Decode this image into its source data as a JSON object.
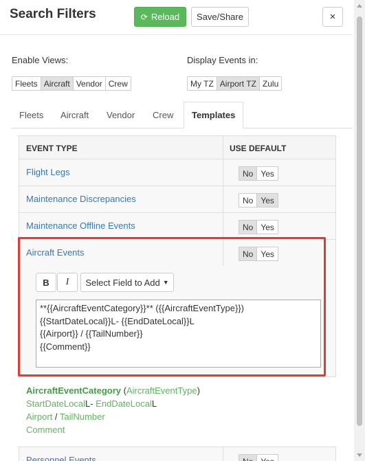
{
  "header": {
    "title": "Search Filters",
    "reload_label": "Reload",
    "save_label": "Save/Share",
    "close_label": "×"
  },
  "enable_views": {
    "label": "Enable Views:",
    "options": [
      "Fleets",
      "Aircraft",
      "Vendor",
      "Crew"
    ],
    "active": "Aircraft"
  },
  "display_events": {
    "label": "Display Events in:",
    "options": [
      "My TZ",
      "Airport TZ",
      "Zulu"
    ],
    "active": "Airport TZ"
  },
  "tabs": [
    "Fleets",
    "Aircraft",
    "Vendor",
    "Crew",
    "Templates"
  ],
  "active_tab": "Templates",
  "table": {
    "col_event_type": "EVENT TYPE",
    "col_use_default": "USE DEFAULT",
    "rows": [
      {
        "name": "Flight Legs",
        "no": "No",
        "yes": "Yes",
        "selected": "No"
      },
      {
        "name": "Maintenance Discrepancies",
        "no": "No",
        "yes": "Yes",
        "selected": "Yes"
      },
      {
        "name": "Maintenance Offline Events",
        "no": "No",
        "yes": "Yes",
        "selected": "No"
      },
      {
        "name": "Aircraft Events",
        "no": "No",
        "yes": "Yes",
        "selected": "No"
      },
      {
        "name": "Personnel Events",
        "no": "No",
        "yes": "Yes",
        "selected": "No"
      }
    ]
  },
  "editor": {
    "bold_label": "B",
    "italic_label": "I",
    "select_field_label": "Select Field to Add",
    "template_lines": [
      "**{{AircraftEventCategory}}** ({{AircraftEventType}})",
      "{{StartDateLocal}}L- {{EndDateLocal}}L",
      "{{Airport}} / {{TailNumber}}",
      "{{Comment}}"
    ]
  },
  "preview": {
    "l1_bold": "AircraftEventCategory",
    "l1_open": " (",
    "l1_type": "AircraftEventType",
    "l1_close": ")",
    "l2_start": "StartDateLocal",
    "l2_mid": "L- ",
    "l2_end": "EndDateLocal",
    "l2_suffix": "L",
    "l3_airport": "Airport",
    "l3_sep": " / ",
    "l3_tail": "TailNumber",
    "l4": "Comment"
  },
  "colors": {
    "reload_button": "#5cb85c",
    "link": "#337ab7",
    "highlight_box": "#e53935"
  }
}
